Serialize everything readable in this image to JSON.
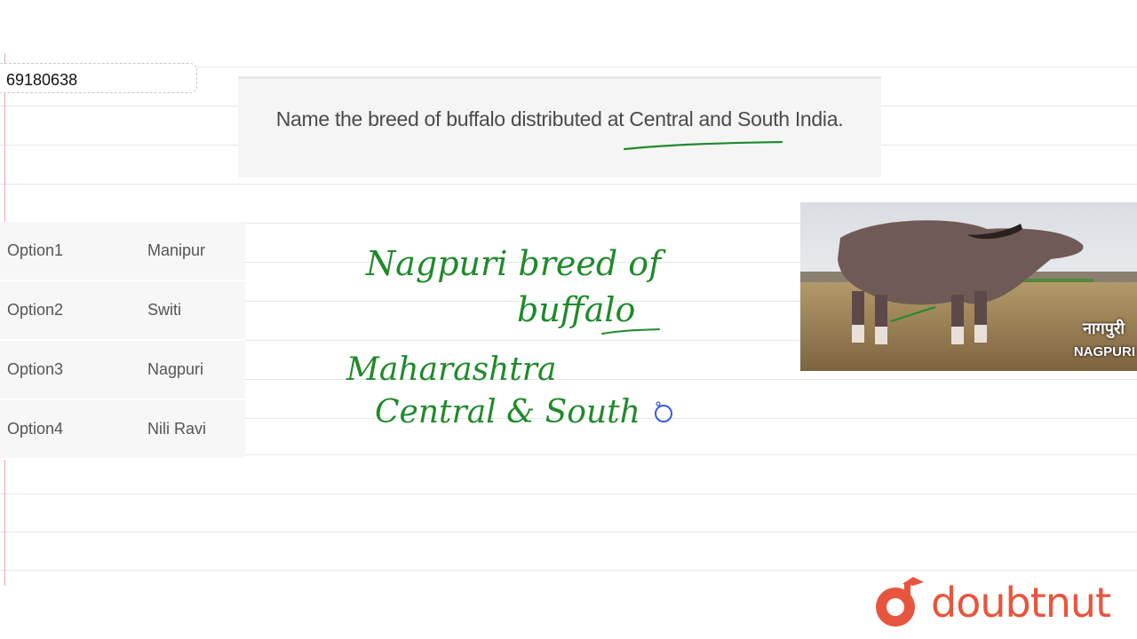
{
  "question_id": "69180638",
  "question": "Name the breed of buffalo distributed at Central and South India.",
  "options": [
    {
      "key": "Option1",
      "value": "Manipur"
    },
    {
      "key": "Option2",
      "value": "Switi"
    },
    {
      "key": "Option3",
      "value": "Nagpuri"
    },
    {
      "key": "Option4",
      "value": "Nili Ravi"
    }
  ],
  "photo": {
    "caption_hindi": "नागपुरी",
    "caption_english": "NAGPURI"
  },
  "handwriting_lines": [
    "Nagpuri breed of",
    "buffalo",
    "Maharashtra",
    "Central & South"
  ],
  "brand": {
    "name": "doubtnut",
    "color": "#e8553e"
  },
  "ink_color": "#1f8a2a"
}
